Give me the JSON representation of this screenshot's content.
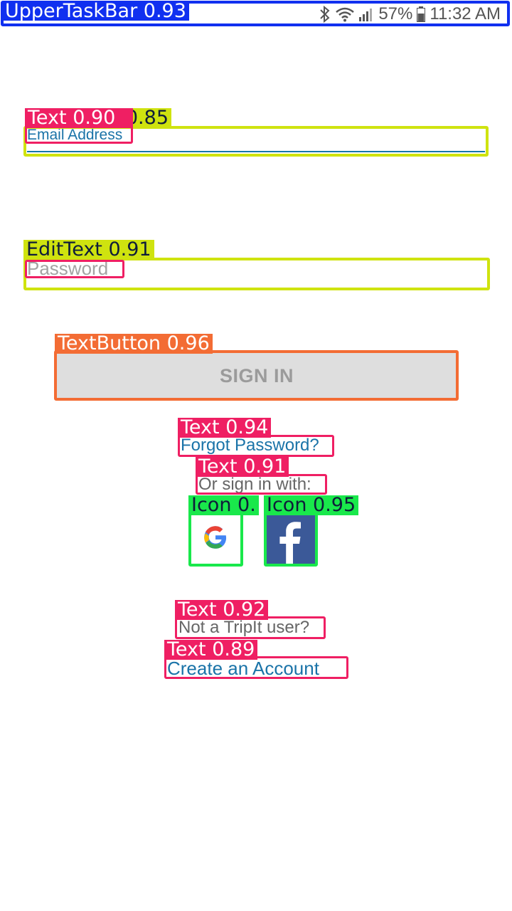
{
  "status_bar": {
    "battery": "57%",
    "time": "11:32 AM",
    "icons": [
      "bluetooth-icon",
      "wifi-icon",
      "signal-icon",
      "battery-icon"
    ]
  },
  "form": {
    "email_label": "Email Address",
    "email_value": "",
    "password_placeholder": "Password",
    "sign_in_label": "SIGN IN",
    "forgot_password": "Forgot Password?",
    "or_sign_in_with": "Or sign in with:",
    "social": [
      "google-icon",
      "facebook-icon"
    ],
    "not_user": "Not a TripIt user?",
    "create_account": "Create an Account"
  },
  "detections": [
    {
      "label": "UpperTaskBar 0.93"
    },
    {
      "label": "Text 0.90"
    },
    {
      "label": "EditText 0.85"
    },
    {
      "label": "EditText 0.91"
    },
    {
      "label": "TextButton 0.96"
    },
    {
      "label": "Text 0.94"
    },
    {
      "label": "Text 0.91"
    },
    {
      "label": "Icon 0."
    },
    {
      "label": "Icon 0.95"
    },
    {
      "label": "Text 0.92"
    },
    {
      "label": "Text 0.89"
    }
  ],
  "colors": {
    "link": "#1a73a8",
    "button_bg": "#dedede",
    "facebook": "#3b5998",
    "taskbar_box": "#1030f0",
    "edittext_box": "#cfe30f",
    "text_box": "#ef1f63",
    "button_box": "#f36c34",
    "icon_box": "#19e84b"
  }
}
